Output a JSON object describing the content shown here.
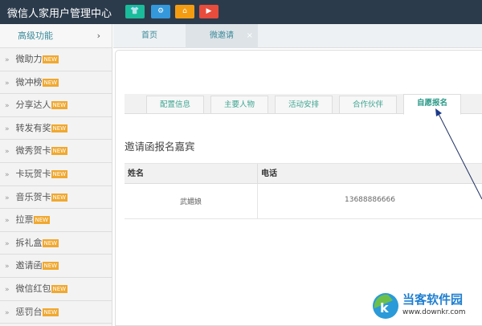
{
  "header": {
    "title": "微信人家用户管理中心",
    "buttons": [
      {
        "icon": "shirt-icon",
        "color": "#1abc9c"
      },
      {
        "icon": "gear-icon",
        "color": "#3498db"
      },
      {
        "icon": "home-icon",
        "color": "#f39c12"
      },
      {
        "icon": "play-icon",
        "color": "#e74c3c"
      }
    ]
  },
  "sidebar": {
    "heading": "高级功能",
    "badge": "NEW",
    "items": [
      {
        "label": "微助力"
      },
      {
        "label": "微冲榜"
      },
      {
        "label": "分享达人"
      },
      {
        "label": "转发有奖"
      },
      {
        "label": "微秀贺卡"
      },
      {
        "label": "卡玩贺卡"
      },
      {
        "label": "音乐贺卡"
      },
      {
        "label": "拉票"
      },
      {
        "label": "拆礼盒"
      },
      {
        "label": "邀请函"
      },
      {
        "label": "微信红包"
      },
      {
        "label": "惩罚台"
      }
    ]
  },
  "tabs": [
    {
      "label": "首页"
    },
    {
      "label": "微邀请"
    }
  ],
  "subtabs": [
    {
      "label": "配置信息"
    },
    {
      "label": "主要人物"
    },
    {
      "label": "活动安排"
    },
    {
      "label": "合作伙伴"
    },
    {
      "label": "自愿报名"
    }
  ],
  "section_title": "邀请函报名嘉宾",
  "table": {
    "headers": [
      "姓名",
      "电话"
    ],
    "rows": [
      [
        "武媚娘",
        "13688886666"
      ]
    ]
  },
  "watermark": {
    "name": "当客软件园",
    "url": "www.downkr.com"
  }
}
